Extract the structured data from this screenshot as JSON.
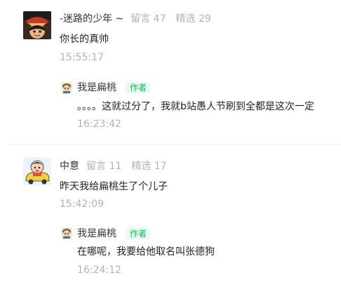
{
  "comments": [
    {
      "nickname": "-迷路的少年 ~",
      "messages": "留言 47",
      "featured": "精选 29",
      "text": "你长的真帅",
      "time": "15:55:17",
      "reply": {
        "nickname": "我是扁桃",
        "badge": "作者",
        "text": "。。。。这就过分了，我就b站愚人节刷到全都是这次一定",
        "time": "16:23:42"
      }
    },
    {
      "nickname": "中意",
      "messages": "留言 11",
      "featured": "精选 17",
      "text": "昨天我给扁桃生了个儿子",
      "time": "15:42:09",
      "reply": {
        "nickname": "我是扁桃",
        "badge": "作者",
        "text": "在哪呢，我要给他取名叫张德狗",
        "time": "16:24:12"
      }
    }
  ],
  "colors": {
    "meta_gray": "#b2b2b2",
    "author_green": "#07c160",
    "badge_bg": "#e9f8ef"
  },
  "icons": {
    "avatar_1": "anime-pirate-avatar-icon",
    "avatar_2": "cartoon-boy-in-car-avatar-icon",
    "author_avatar": "author-cartoon-avatar-icon"
  }
}
